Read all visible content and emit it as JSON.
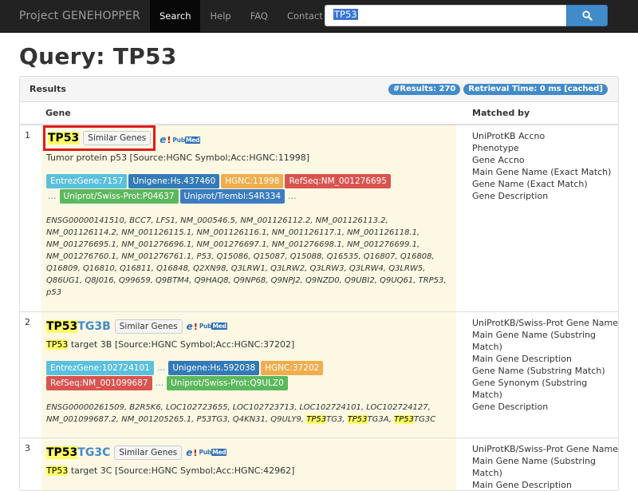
{
  "navbar": {
    "brand": "Project GENEHOPPER",
    "items": [
      "Search",
      "Help",
      "FAQ",
      "Contact"
    ],
    "active": "Search",
    "search_value": "TP53"
  },
  "page": {
    "title": "Query: TP53"
  },
  "panel": {
    "title": "Results",
    "badge_results": "#Results: 270",
    "badge_time": "Retrieval Time: 0 ms [cached]"
  },
  "table": {
    "col_gene": "Gene",
    "col_matched": "Matched by"
  },
  "common": {
    "similar_label": "Similar Genes",
    "ellipsis": "..."
  },
  "rows": [
    {
      "index": "1",
      "symbol_hl": "TP53",
      "symbol_rest": "",
      "desc_hl": "",
      "desc_rest": "Tumor protein p53 [Source:HGNC Symbol;Acc:HGNC:11998]",
      "tags": {
        "entrez": "EntrezGene:7157",
        "unigene": "Unigene:Hs.437460",
        "hgnc": "HGNC:11998",
        "refseq": "RefSeq:NM_001276695",
        "swiss": "Uniprot/Swiss-Prot:P04637",
        "trembl": "Uniprot/Trembl:S4R334"
      },
      "synonyms": "ENSG00000141510, BCC7, LFS1, NM_000546.5, NM_001126112.2, NM_001126113.2, NM_001126114.2, NM_001126115.1, NM_001126116.1, NM_001126117.1, NM_001126118.1, NM_001276695.1, NM_001276696.1, NM_001276697.1, NM_001276698.1, NM_001276699.1, NM_001276760.1, NM_001276761.1, P53, Q15086, Q15087, Q15088, Q16535, Q16807, Q16808, Q16809, Q16810, Q16811, Q16848, Q2XN98, Q3LRW1, Q3LRW2, Q3LRW3, Q3LRW4, Q3LRW5, Q86UG1, Q8J016, Q99659, Q9BTM4, Q9HAQ8, Q9NP68, Q9NPJ2, Q9NZD0, Q9UBI2, Q9UQ61, TRP53, p53",
      "matched": [
        "UniProtKB Accno",
        "Phenotype",
        "Gene Accno",
        "Main Gene Name (Exact Match)",
        "Gene Name (Exact Match)",
        "Gene Description"
      ]
    },
    {
      "index": "2",
      "symbol_hl": "TP53",
      "symbol_rest": "TG3B",
      "desc_hl": "TP53",
      "desc_rest": " target 3B [Source:HGNC Symbol;Acc:HGNC:37202]",
      "tags": {
        "entrez": "EntrezGene:102724101",
        "unigene": "Unigene:Hs.592038",
        "hgnc": "HGNC:37202",
        "refseq": "RefSeq:NM_001099687",
        "swiss": "Uniprot/Swiss-Prot:Q9ULZ0"
      },
      "synonyms_a": "ENSG00000261509, B2R5K6, LOC102723655, LOC102723713, LOC102724101, LOC102724127, NM_001099687.2, NM_001205265.1, P53TG3, Q4KN31, Q9ULY9, ",
      "syn_hl": "TP53",
      "syn_b": "TG3, ",
      "syn_c": "TG3A, ",
      "syn_d": "TG3C",
      "matched": [
        "UniProtKB/Swiss-Prot Gene Name",
        "Main Gene Name (Substring Match)",
        "Main Gene Description",
        "Gene Name (Substring Match)",
        "Gene Synonym (Substring Match)",
        "Gene Description"
      ]
    },
    {
      "index": "3",
      "symbol_hl": "TP53",
      "symbol_rest": "TG3C",
      "desc_hl": "TP53",
      "desc_rest": " target 3C [Source:HGNC Symbol;Acc:HGNC:42962]",
      "matched": [
        "UniProtKB/Swiss-Prot Gene Name",
        "Main Gene Name (Substring Match)",
        "Main Gene Description"
      ]
    }
  ]
}
